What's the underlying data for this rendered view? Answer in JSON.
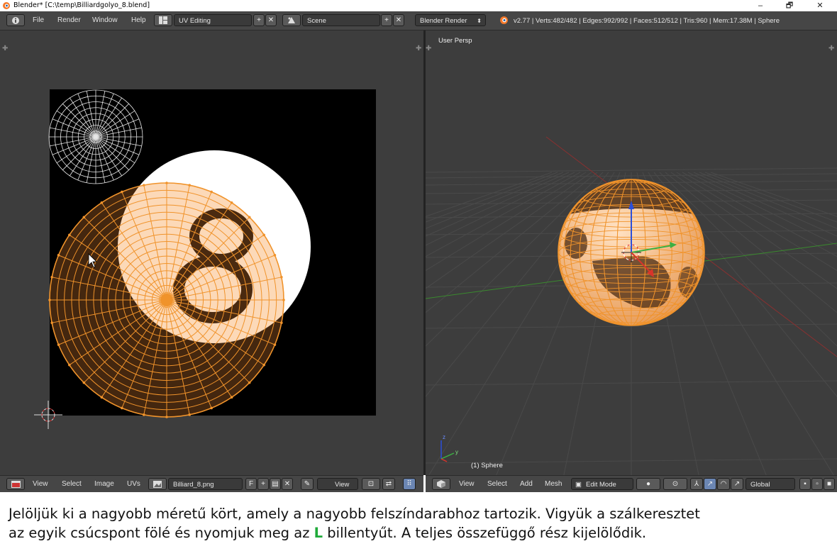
{
  "window": {
    "title": "Blender* [C:\\temp\\Billiardgolyo_8.blend]",
    "minimize": "–",
    "restore": "🗗",
    "close": "✕"
  },
  "infobar": {
    "menu": [
      "File",
      "Render",
      "Window",
      "Help"
    ],
    "layout": "UV Editing",
    "scene": "Scene",
    "engine": "Blender Render",
    "stats": "v2.77 | Verts:482/482 | Edges:992/992 | Faces:512/512 | Tris:960 | Mem:17.38M | Sphere"
  },
  "uv_editor": {
    "menu": [
      "View",
      "Select",
      "Image",
      "UVs"
    ],
    "image_name": "Billiard_8.png",
    "fake_user": "F",
    "view_dropdown": "View"
  },
  "viewport": {
    "view_label": "User Persp",
    "object_label": "(1) Sphere",
    "menu": [
      "View",
      "Select",
      "Add",
      "Mesh"
    ],
    "mode": "Edit Mode",
    "orientation": "Global"
  },
  "caption": {
    "line1": "Jelöljük ki a nagyobb méretű kört, amely a nagyobb felszíndarabhoz tartozik. Vigyük a szálkeresztet",
    "line2_before": "az egyik csúcspont fölé és nyomjuk meg az",
    "key": "L",
    "line2_after": "billentyűt. A teljes összefüggő rész kijelölődik."
  },
  "colors": {
    "panel_bg": "#3d3d3d",
    "header_bg": "#464646",
    "uv_select": "#f0932b",
    "ball_light": "#fcd9b8",
    "ball_dark": "#4a2a10",
    "axis_x": "#d9342b",
    "axis_y": "#3cb043",
    "axis_z": "#2b4fd9"
  }
}
